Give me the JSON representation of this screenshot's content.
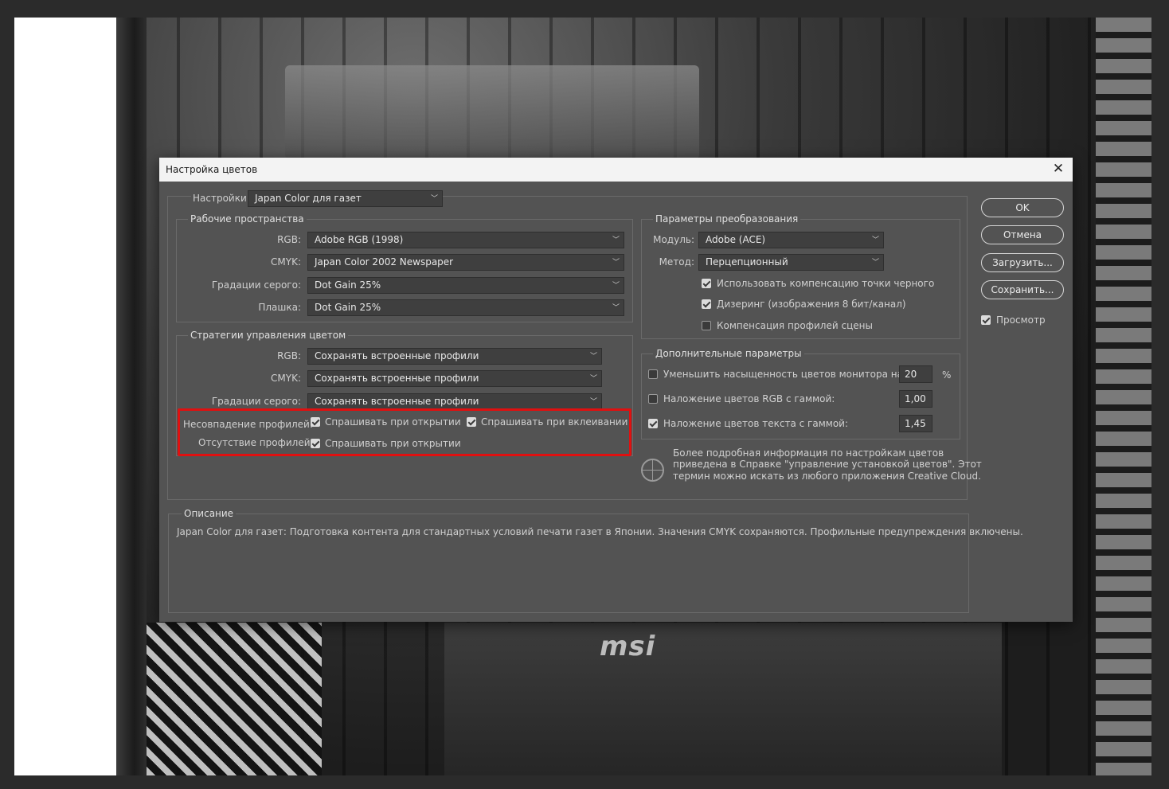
{
  "dialog": {
    "title": "Настройка цветов",
    "close_glyph": "✕",
    "settings_label": "Настройки:",
    "settings_value": "Japan Color для газет"
  },
  "working_spaces": {
    "title": "Рабочие пространства",
    "rows": [
      {
        "label": "RGB:",
        "value": "Adobe RGB (1998)"
      },
      {
        "label": "CMYK:",
        "value": "Japan Color 2002 Newspaper"
      },
      {
        "label": "Градации серого:",
        "value": "Dot Gain 25%"
      },
      {
        "label": "Плашка:",
        "value": "Dot Gain 25%"
      }
    ]
  },
  "policies": {
    "title": "Стратегии управления цветом",
    "rows": [
      {
        "label": "RGB:",
        "value": "Сохранять встроенные профили"
      },
      {
        "label": "CMYK:",
        "value": "Сохранять встроенные профили"
      },
      {
        "label": "Градации серого:",
        "value": "Сохранять встроенные профили"
      }
    ],
    "mismatch_label": "Несовпадение профилей:",
    "mismatch_open": "Спрашивать при открытии",
    "mismatch_paste": "Спрашивать при вклеивании",
    "missing_label": "Отсутствие профилей:",
    "missing_open": "Спрашивать при открытии"
  },
  "conversion": {
    "title": "Параметры преобразования",
    "engine_label": "Модуль:",
    "engine_value": "Adobe (ACE)",
    "intent_label": "Метод:",
    "intent_value": "Перцепционный",
    "bpc": "Использовать компенсацию точки черного",
    "dither": "Дизеринг (изображения 8 бит/канал)",
    "scene": "Компенсация профилей сцены"
  },
  "advanced": {
    "title": "Дополнительные параметры",
    "desaturate": "Уменьшить насыщенность цветов монитора на:",
    "desaturate_value": "20",
    "desaturate_unit": "%",
    "blend_rgb": "Наложение цветов RGB с гаммой:",
    "blend_rgb_value": "1,00",
    "blend_text": "Наложение цветов текста с гаммой:",
    "blend_text_value": "1,45"
  },
  "info": {
    "line1": "Более подробная информация по настройкам цветов",
    "line2": "приведена в Справке \"управление установкой цветов\". Этот",
    "line3": "термин можно искать из любого приложения Creative Cloud."
  },
  "description": {
    "title": "Описание",
    "text": "Japan Color для газет:  Подготовка контента для стандартных условий печати газет в Японии. Значения CMYK сохраняются. Профильные предупреждения включены."
  },
  "buttons": {
    "ok": "OK",
    "cancel": "Отмена",
    "load": "Загрузить...",
    "save": "Сохранить...",
    "preview": "Просмотр"
  },
  "background": {
    "logo_text": "msi"
  },
  "colors": {
    "dialog_bg": "#535353",
    "highlight": "#e01010",
    "titlebar": "#f3f3f3"
  }
}
